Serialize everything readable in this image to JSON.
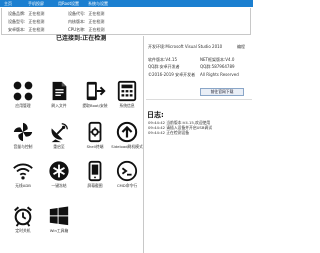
{
  "menu": [
    "主页",
    "手机投屏",
    "用Root设置",
    "系统与设置"
  ],
  "device_info": {
    "left": [
      {
        "label": "设备品牌:",
        "value": "正在检测"
      },
      {
        "label": "设备型号:",
        "value": "正在检测"
      },
      {
        "label": "安卓版本:",
        "value": "正在检测"
      }
    ],
    "right": [
      {
        "label": "设备代号:",
        "value": "正在检测"
      },
      {
        "label": "内核版本:",
        "value": "正在检测"
      },
      {
        "label": "CPU名称:",
        "value": "正在检测"
      }
    ]
  },
  "status_title": "已连接到:正在检测",
  "tools": [
    {
      "name": "应用管理",
      "icon": "apps-grid-icon"
    },
    {
      "name": "刷入文件",
      "icon": "document-icon"
    },
    {
      "name": "提取Boot/安装",
      "icon": "phone-install-icon"
    },
    {
      "name": "系统信息",
      "icon": "calculator-icon"
    },
    {
      "name": "音量与控制",
      "icon": "pinwheel-icon"
    },
    {
      "name": "重启至",
      "icon": "satellite-dish-icon"
    },
    {
      "name": "Shell终端",
      "icon": "phone-gear-icon"
    },
    {
      "name": "Sideload刷机模式",
      "icon": "upload-circle-icon"
    },
    {
      "name": "无线ADB",
      "icon": "wifi-adb-icon"
    },
    {
      "name": "一键冻结",
      "icon": "snowflake-icon"
    },
    {
      "name": "屏幕截图",
      "icon": "phone-screen-icon"
    },
    {
      "name": "CMD命令行",
      "icon": "terminal-icon"
    },
    {
      "name": "定时关机",
      "icon": "alarm-clock-icon"
    },
    {
      "name": "Win工具箱",
      "icon": "windows-logo-icon"
    }
  ],
  "env": {
    "left": [
      "开发环境:Microsoft Visual Studio 2010",
      "软件版本:V4.15",
      "QQ群:安卓开发者",
      "©2016-2019 安卓开发者"
    ],
    "right": [
      "编程",
      "NET框架版本:V4.0",
      "QQ群:587964789",
      "All Rights Reserved"
    ],
    "button": "前往官网下载"
  },
  "log": {
    "title": "日志:",
    "lines": [
      "09:44:42 当前版本:V4.15,欢迎使用",
      "09:44:42 请插入设备并开启USB调试",
      "09:44:42 正在检测设备"
    ]
  },
  "colors": {
    "menubar": "#1b7fd0",
    "icon": "#111111"
  }
}
